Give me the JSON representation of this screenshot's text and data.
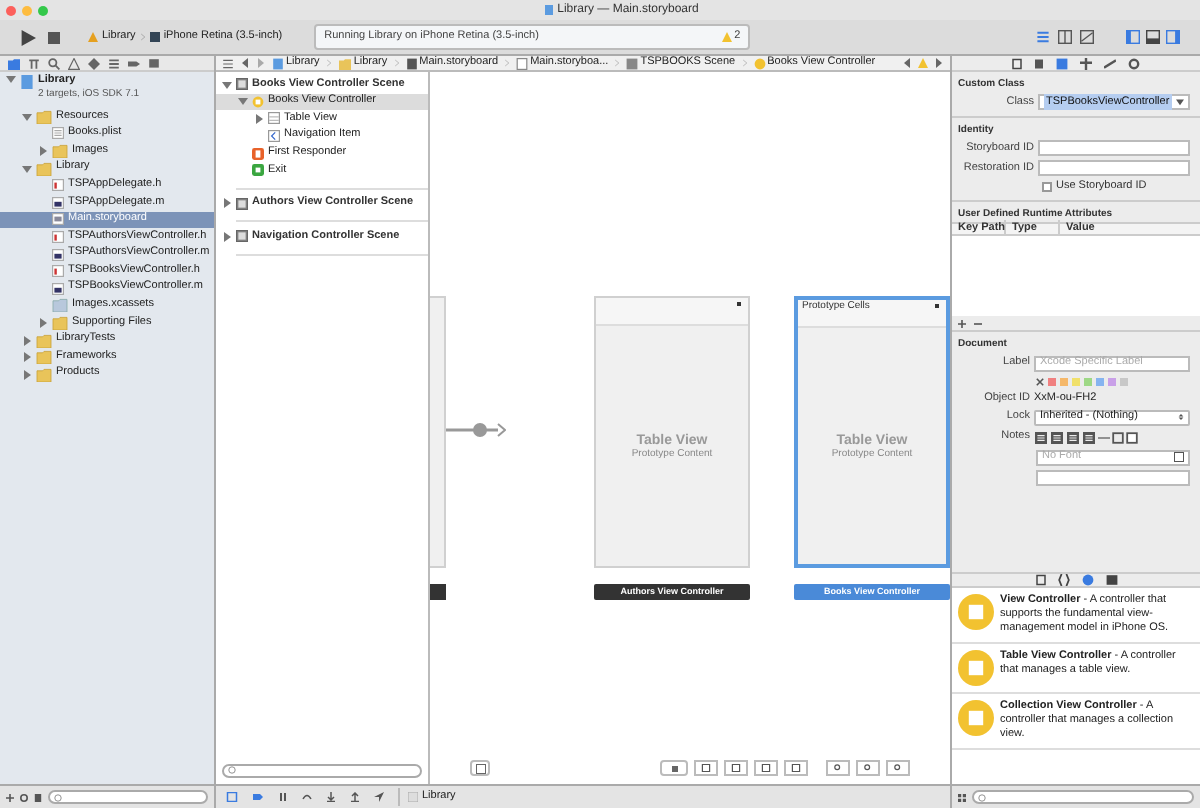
{
  "window": {
    "title": "Library — Main.storyboard"
  },
  "toolbar": {
    "scheme": "Library",
    "device": "iPhone Retina (3.5-inch)",
    "status": "Running Library on iPhone Retina (3.5-inch)",
    "warnings": "2"
  },
  "navigator": {
    "project": {
      "name": "Library",
      "subtitle": "2 targets, iOS SDK 7.1",
      "expanded": true
    },
    "items": [
      {
        "label": "Resources",
        "kind": "group",
        "expanded": true,
        "selected": false,
        "children": [
          {
            "label": "Books.plist",
            "kind": "plist",
            "selected": false
          },
          {
            "label": "Images",
            "kind": "group",
            "expanded": false,
            "selected": false
          }
        ]
      },
      {
        "label": "Library",
        "kind": "group",
        "expanded": true,
        "selected": false,
        "children": [
          {
            "label": "TSPAppDelegate.h",
            "kind": "header",
            "selected": false
          },
          {
            "label": "TSPAppDelegate.m",
            "kind": "source",
            "selected": false
          },
          {
            "label": "Main.storyboard",
            "kind": "storyboard",
            "selected": true
          },
          {
            "label": "TSPAuthorsViewController.h",
            "kind": "header",
            "selected": false
          },
          {
            "label": "TSPAuthorsViewController.m",
            "kind": "source",
            "selected": false
          },
          {
            "label": "TSPBooksViewController.h",
            "kind": "header",
            "selected": false
          },
          {
            "label": "TSPBooksViewController.m",
            "kind": "source",
            "selected": false
          },
          {
            "label": "Images.xcassets",
            "kind": "assets",
            "selected": false
          },
          {
            "label": "Supporting Files",
            "kind": "group",
            "expanded": false,
            "selected": false
          }
        ]
      },
      {
        "label": "LibraryTests",
        "kind": "group",
        "expanded": false,
        "selected": false
      },
      {
        "label": "Frameworks",
        "kind": "group",
        "expanded": false,
        "selected": false
      },
      {
        "label": "Products",
        "kind": "group",
        "expanded": false,
        "selected": false
      }
    ]
  },
  "jump_bar": [
    {
      "label": "Library",
      "kind": "project"
    },
    {
      "label": "Library",
      "kind": "folder"
    },
    {
      "label": "Main.storyboard",
      "kind": "storyboard"
    },
    {
      "label": "Main.storyboa...",
      "kind": "file"
    },
    {
      "label": "TSPBOOKS Scene",
      "kind": "scene"
    },
    {
      "label": "Books View Controller",
      "kind": "controller"
    }
  ],
  "outline": [
    {
      "label": "Books View Controller Scene",
      "kind": "scene",
      "expanded": true,
      "selected": false,
      "children": [
        {
          "label": "Books View Controller",
          "kind": "controller",
          "expanded": true,
          "selected": true,
          "children": [
            {
              "label": "Table View",
              "kind": "tableview",
              "expanded": false,
              "selected": false
            },
            {
              "label": "Navigation Item",
              "kind": "navitem",
              "selected": false
            }
          ]
        },
        {
          "label": "First Responder",
          "kind": "responder",
          "selected": false
        },
        {
          "label": "Exit",
          "kind": "exit",
          "selected": false
        }
      ]
    },
    {
      "label": "Authors View Controller Scene",
      "kind": "scene",
      "expanded": false,
      "selected": false
    },
    {
      "label": "Navigation Controller Scene",
      "kind": "scene",
      "expanded": false,
      "selected": false
    }
  ],
  "canvas": {
    "scenes": [
      {
        "title": "Table View",
        "subtitle": "Prototype Content",
        "label": "Authors View Controller",
        "selected": false
      },
      {
        "header": "Prototype Cells",
        "title": "Table View",
        "subtitle": "Prototype Content",
        "label": "Books View Controller",
        "selected": true
      }
    ]
  },
  "inspector": {
    "custom_class": {
      "heading": "Custom Class",
      "class_label": "Class",
      "class_value": "TSPBooksViewController"
    },
    "identity": {
      "heading": "Identity",
      "storyboard_id_label": "Storyboard ID",
      "restoration_id_label": "Restoration ID",
      "use_storyboard_id": {
        "label": "Use Storyboard ID",
        "checked": false
      }
    },
    "runtime_attributes": {
      "heading": "User Defined Runtime Attributes",
      "columns": [
        "Key Path",
        "Type",
        "Value"
      ]
    },
    "document": {
      "heading": "Document",
      "label_label": "Label",
      "label_placeholder": "Xcode Specific Label",
      "swatches": [
        {
          "kind": "none"
        },
        {
          "color": "#f08080"
        },
        {
          "color": "#f5b86a"
        },
        {
          "color": "#f0e06a"
        },
        {
          "color": "#9ed886"
        },
        {
          "color": "#86b4f0"
        },
        {
          "color": "#c9a0e8"
        },
        {
          "color": "#c8c8c8"
        }
      ],
      "object_id_label": "Object ID",
      "object_id": "XxM-ou-FH2",
      "lock_label": "Lock",
      "lock_value": "Inherited - (Nothing)",
      "notes_label": "Notes",
      "font_placeholder": "No Font"
    }
  },
  "library": [
    {
      "text": "**View Controller** - A controller that supports the fundamental view-management model in iPhone OS."
    },
    {
      "text": "**Table View Controller** - A controller that manages a table view."
    },
    {
      "text": "**Collection View Controller** - A controller that manages a collection view."
    }
  ],
  "debug_bar": {
    "target": "Library"
  }
}
